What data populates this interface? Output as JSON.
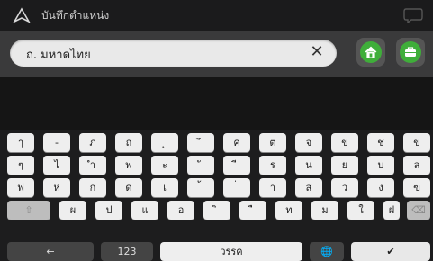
{
  "window": {
    "title": "บันทึกตำแหน่ง"
  },
  "search": {
    "value": "ถ. มหาดไทย",
    "clear_symbol": "✕"
  },
  "quick_buttons": {
    "home_icon": "home-icon",
    "work_icon": "briefcase-icon"
  },
  "keyboard": {
    "row1": [
      "ๅ",
      "-",
      "ภ",
      "ถ",
      "ุ",
      "ึ",
      "ค",
      "ต",
      "จ",
      "ข",
      "ช",
      "ข"
    ],
    "row2": [
      "ๆ",
      "ไ",
      "ำ",
      "พ",
      "ะ",
      "ั",
      "ี",
      "ร",
      "น",
      "ย",
      "บ",
      "ล"
    ],
    "row3": [
      "ฟ",
      "ห",
      "ก",
      "ด",
      "เ",
      "้",
      "่",
      "า",
      "ส",
      "ว",
      "ง",
      "ฃ"
    ],
    "row4": [
      "ผ",
      "ป",
      "แ",
      "อ",
      "ิ",
      "ื",
      "ท",
      "ม",
      "ใ",
      "ฝ"
    ],
    "bottom": {
      "back": "←",
      "numbers": "123",
      "space": "วรรค",
      "globe": "🌐",
      "done": "✔"
    },
    "shift": "⇧",
    "backspace": "⌫"
  }
}
